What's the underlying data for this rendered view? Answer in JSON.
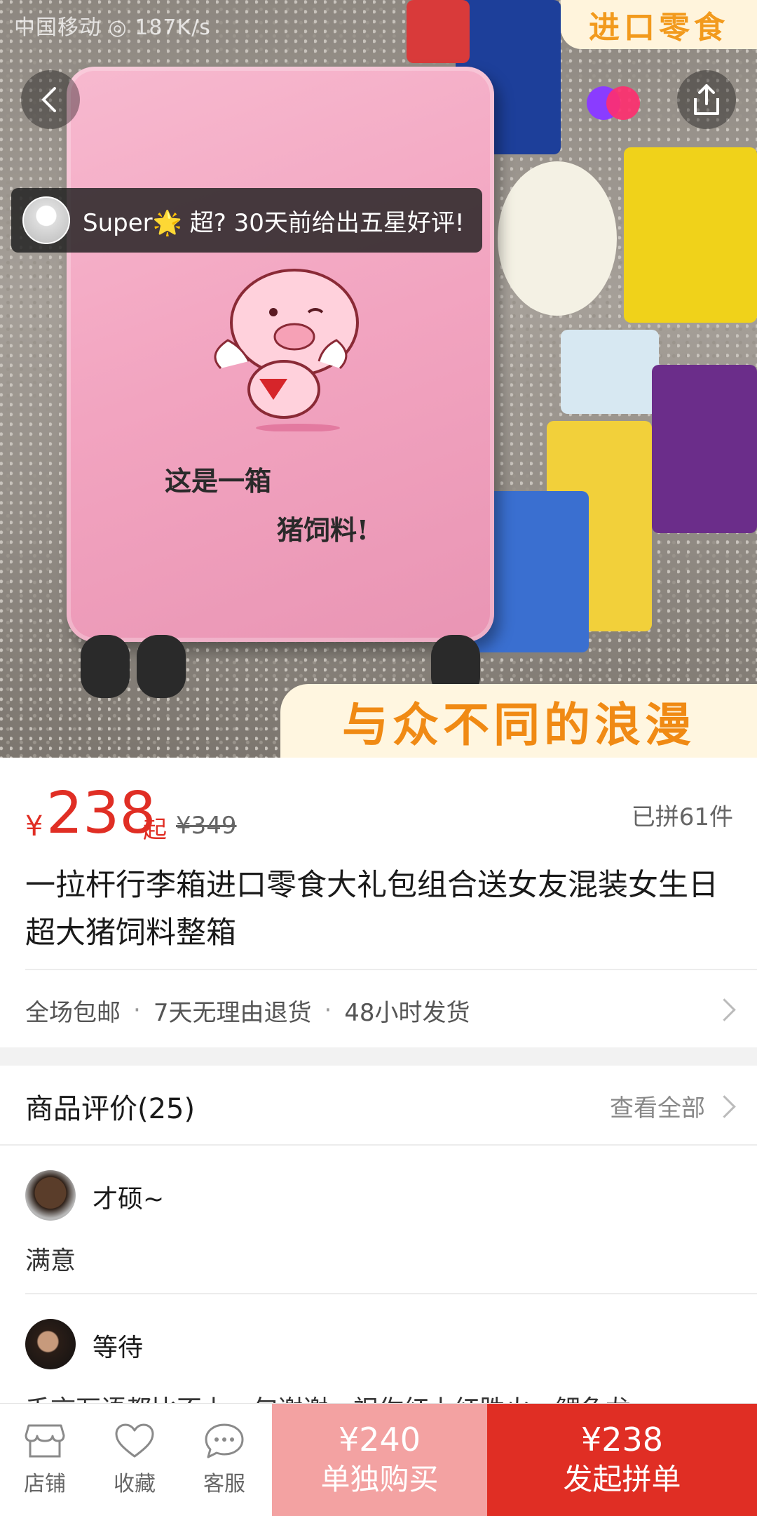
{
  "status_bar": {
    "text": "中国移动 ◎ 187K/s"
  },
  "hero": {
    "banner_top": "进口零食",
    "banner_bottom": "与众不同的浪漫",
    "case_text_line1": "这是一箱",
    "case_text_line2": "猪饲料!"
  },
  "toast": {
    "text": "Super🌟 超? 30天前给出五星好评!"
  },
  "product": {
    "currency": "¥",
    "price": "238",
    "price_suffix": "起",
    "original_price": "¥349",
    "sold": "已拼61件",
    "title": "一拉杆行李箱进口零食大礼包组合送女友混装女生日超大猪饲料整箱",
    "services": [
      "全场包邮",
      "7天无理由退货",
      "48小时发货"
    ]
  },
  "reviews": {
    "title": "商品评价(25)",
    "view_all": "查看全部",
    "items": [
      {
        "name": "才硕~",
        "text": "满意"
      },
      {
        "name": "等待",
        "text": "千言万语都比不上一句谢谢，祝你红上红胜火，鲤鱼龙"
      }
    ]
  },
  "bottom_bar": {
    "tabs": [
      {
        "label": "店铺",
        "icon": "store-icon"
      },
      {
        "label": "收藏",
        "icon": "heart-icon"
      },
      {
        "label": "客服",
        "icon": "chat-icon"
      }
    ],
    "single_price": "¥240",
    "single_label": "单独购买",
    "group_price": "¥238",
    "group_label": "发起拼单"
  },
  "colors": {
    "accent": "#e02e24",
    "single_buy_bg": "#f3a2a2",
    "text_gray": "#666666"
  }
}
